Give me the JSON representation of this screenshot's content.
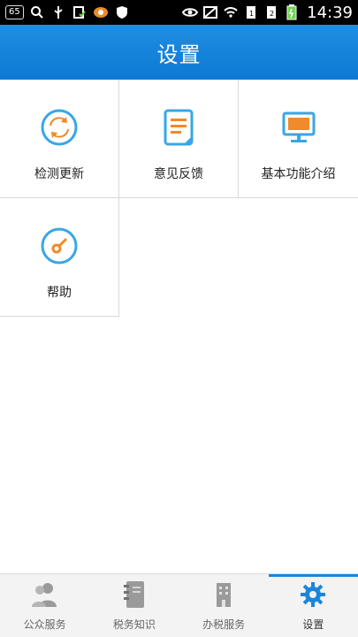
{
  "statusbar": {
    "badge": "65",
    "time": "14:39"
  },
  "header": {
    "title": "设置"
  },
  "grid": {
    "items": [
      {
        "label": "检测更新",
        "icon": "refresh-icon"
      },
      {
        "label": "意见反馈",
        "icon": "feedback-document-icon"
      },
      {
        "label": "基本功能介绍",
        "icon": "monitor-icon"
      },
      {
        "label": "帮助",
        "icon": "help-gauge-icon"
      }
    ]
  },
  "bottom_nav": {
    "items": [
      {
        "label": "公众服务",
        "icon": "users-icon"
      },
      {
        "label": "税务知识",
        "icon": "notebook-icon"
      },
      {
        "label": "办税服务",
        "icon": "building-icon"
      },
      {
        "label": "设置",
        "icon": "gear-icon",
        "active": true
      }
    ]
  },
  "colors": {
    "header": "#1a86db",
    "accent_blue": "#3aa6e6",
    "accent_orange": "#f08a2a"
  }
}
